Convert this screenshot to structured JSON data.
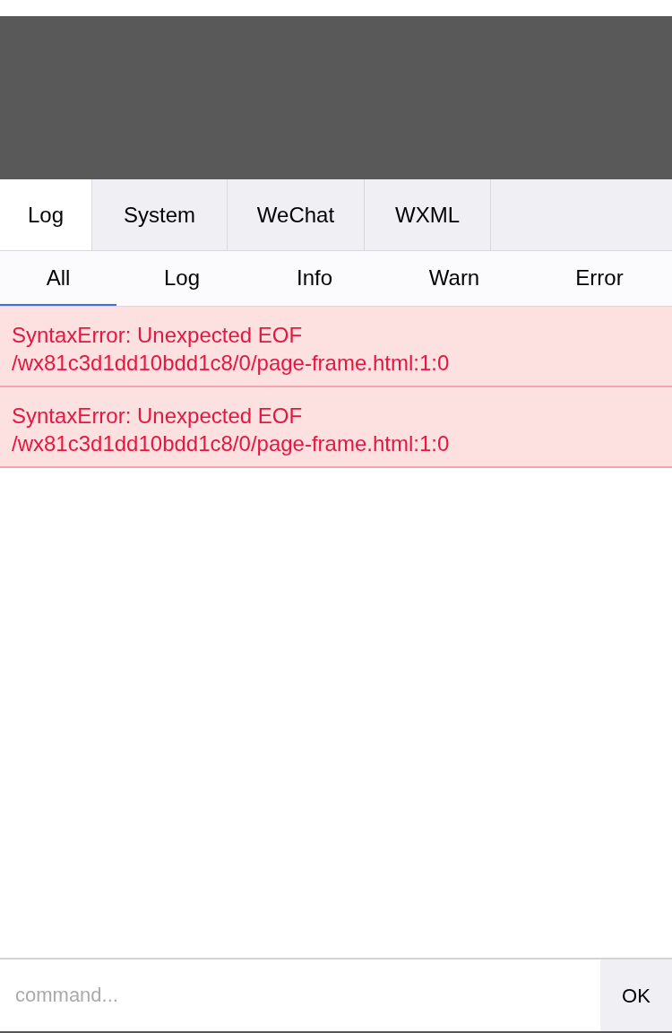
{
  "tabs": [
    {
      "label": "Log",
      "selected": true
    },
    {
      "label": "System",
      "selected": false
    },
    {
      "label": "WeChat",
      "selected": false
    },
    {
      "label": "WXML",
      "selected": false
    }
  ],
  "filters": [
    {
      "label": "All",
      "selected": true
    },
    {
      "label": "Log",
      "selected": false
    },
    {
      "label": "Info",
      "selected": false
    },
    {
      "label": "Warn",
      "selected": false
    },
    {
      "label": "Error",
      "selected": false
    }
  ],
  "entries": [
    {
      "kind": "error",
      "lines": [
        "SyntaxError: Unexpected EOF",
        "/wx81c3d1dd10bdd1c8/0/page-frame.html:1:0"
      ]
    },
    {
      "kind": "error",
      "lines": [
        "SyntaxError: Unexpected EOF",
        "/wx81c3d1dd10bdd1c8/0/page-frame.html:1:0"
      ]
    }
  ],
  "command": {
    "placeholder": "command...",
    "button": "OK"
  }
}
